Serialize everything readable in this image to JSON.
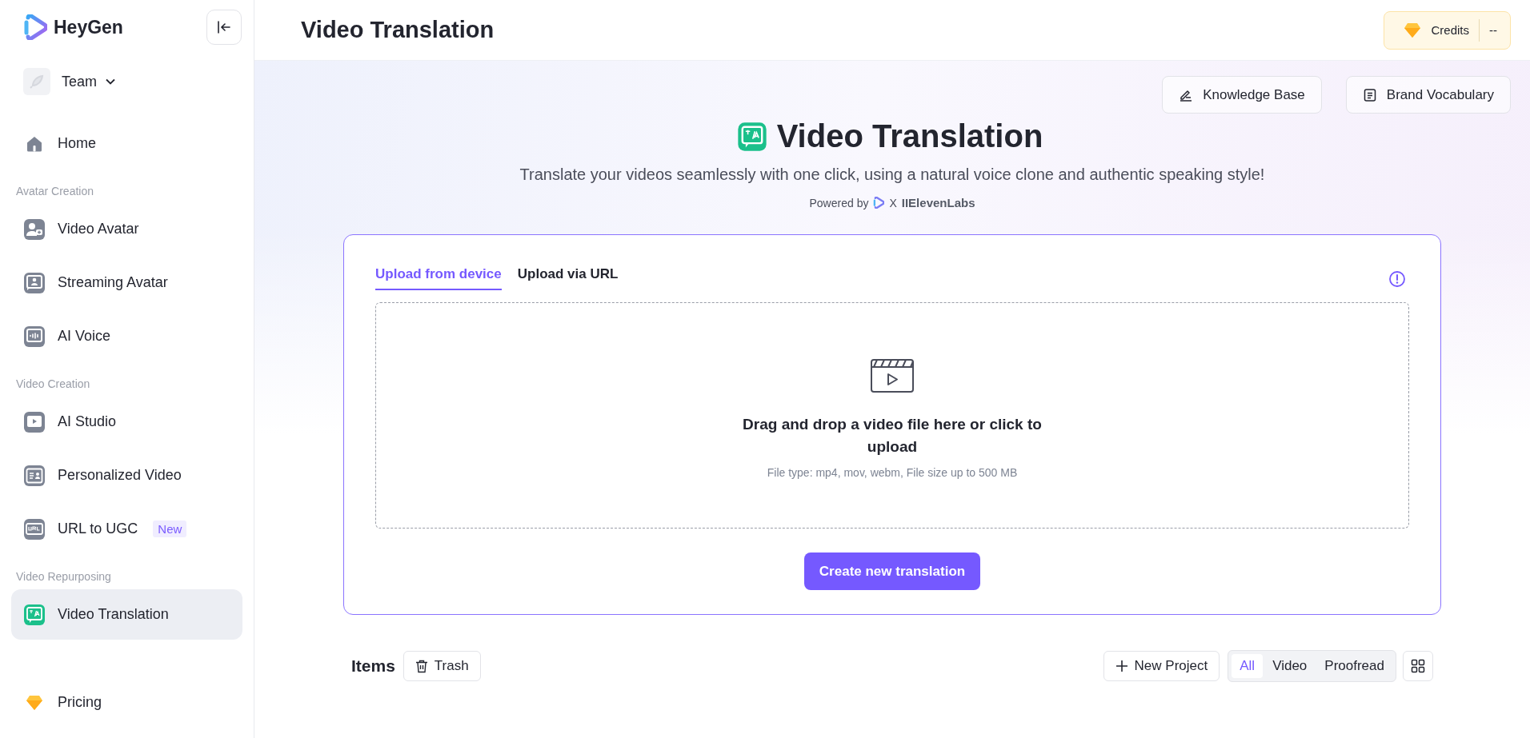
{
  "sidebar": {
    "logo": "HeyGen",
    "team": {
      "label": "Team"
    },
    "home": {
      "label": "Home",
      "selected": false
    },
    "groups": [
      {
        "title": "Avatar Creation",
        "items": [
          {
            "label": "Video Avatar",
            "selected": false
          },
          {
            "label": "Streaming Avatar",
            "selected": false
          },
          {
            "label": "AI Voice",
            "selected": false
          }
        ]
      },
      {
        "title": "Video Creation",
        "items": [
          {
            "label": "AI Studio",
            "selected": false
          },
          {
            "label": "Personalized Video",
            "selected": false
          },
          {
            "label": "URL to UGC",
            "selected": false,
            "badge": "New"
          }
        ]
      },
      {
        "title": "Video Repurposing",
        "items": [
          {
            "label": "Video Translation",
            "selected": true
          }
        ]
      }
    ],
    "pricing": {
      "label": "Pricing",
      "selected": false
    }
  },
  "header": {
    "title": "Video Translation",
    "credits": {
      "label": "Credits",
      "value": "--"
    }
  },
  "hero": {
    "buttons": [
      "Knowledge Base",
      "Brand Vocabulary"
    ],
    "title": "Video Translation",
    "subtitle": "Translate your videos seamlessly with one click, using a natural voice clone and authentic speaking style!",
    "powered_by": "Powered by",
    "partner_separator": "X",
    "partner": "IIElevenLabs"
  },
  "upload": {
    "tabs": [
      {
        "label": "Upload from device",
        "selected": true
      },
      {
        "label": "Upload via URL",
        "selected": false
      }
    ],
    "dropzone": {
      "title": "Drag and drop a video file here or click to upload",
      "hint": "File type: mp4, mov, webm, File size up to 500 MB"
    },
    "button": "Create new translation"
  },
  "items_bar": {
    "title": "Items",
    "trash": "Trash",
    "new_project": "New Project",
    "filters": [
      {
        "label": "All",
        "selected": true
      },
      {
        "label": "Video",
        "selected": false
      },
      {
        "label": "Proofread",
        "selected": false
      }
    ]
  }
}
